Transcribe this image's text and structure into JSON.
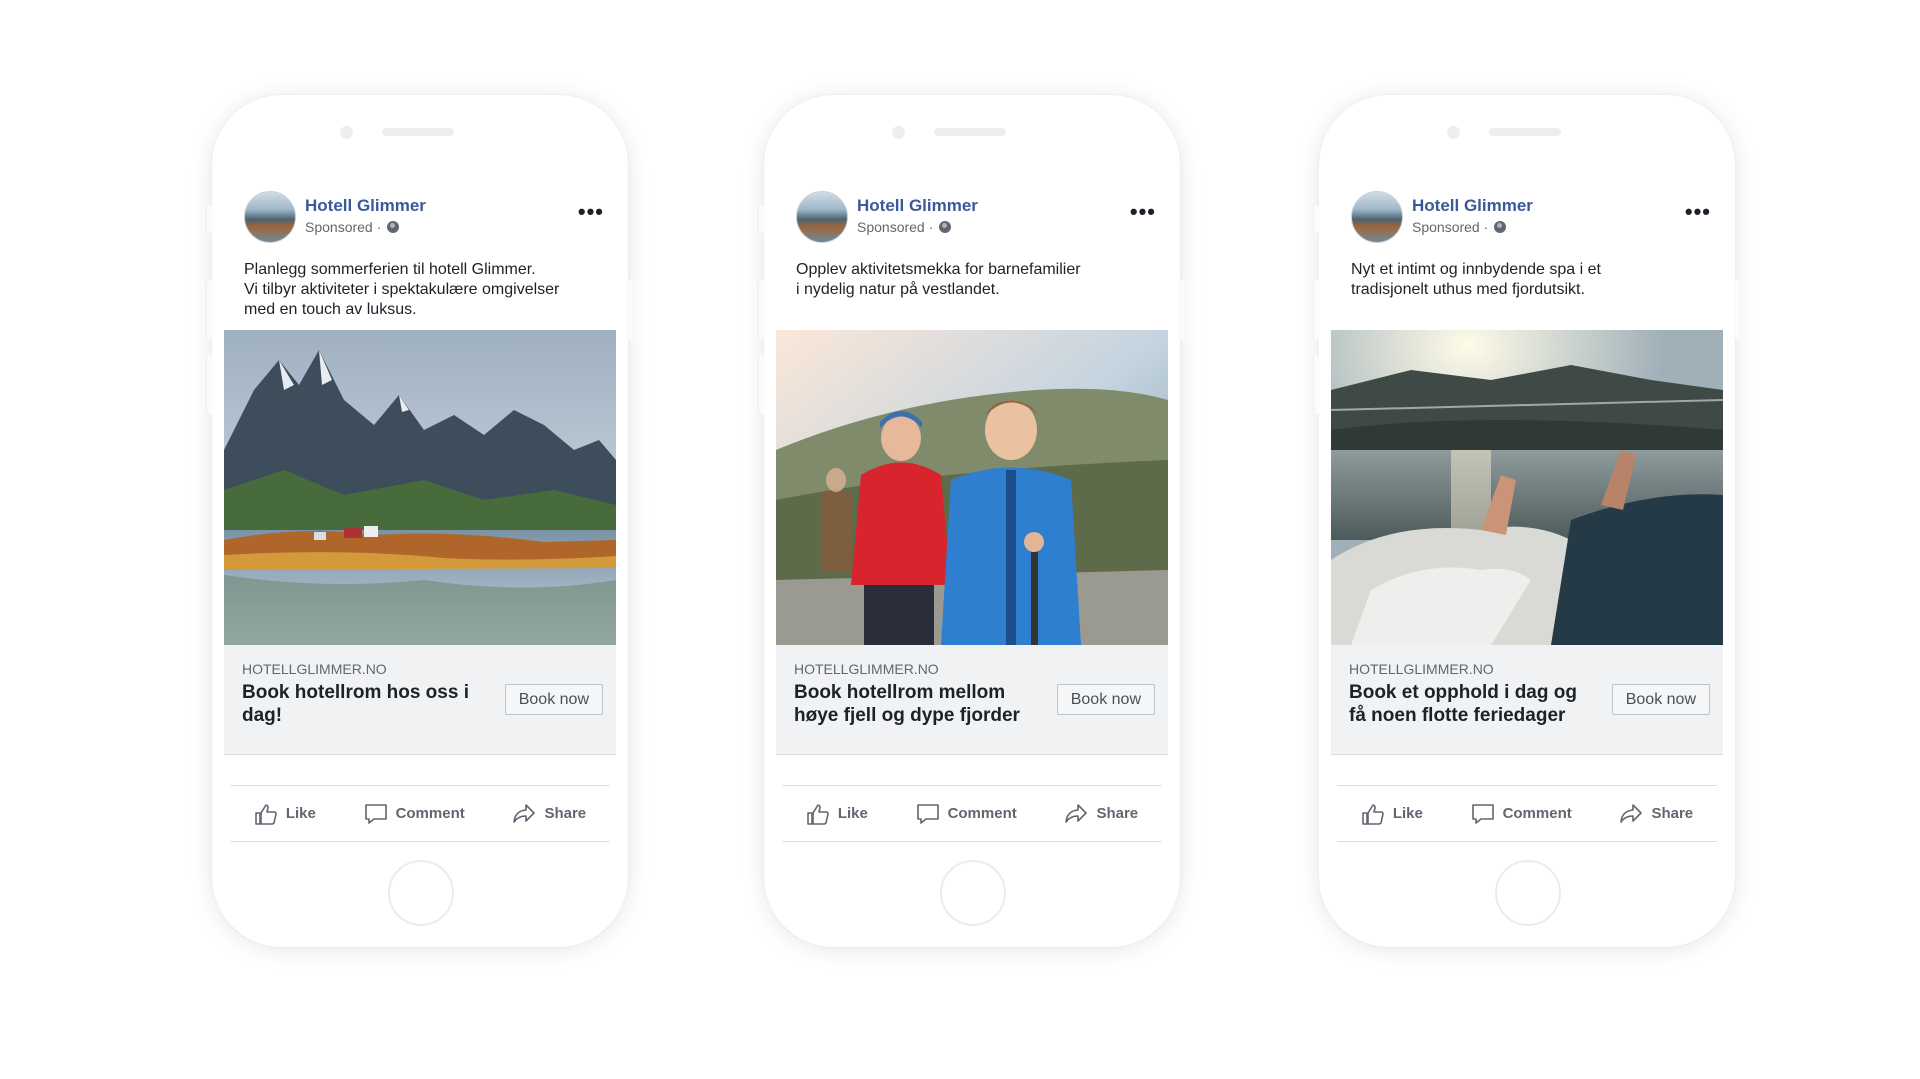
{
  "brand": {
    "page_name": "Hotell Glimmer",
    "sponsored": "Sponsored ·",
    "name_color": "#3b5998"
  },
  "actions": {
    "like": "Like",
    "comment": "Comment",
    "share": "Share"
  },
  "ads": [
    {
      "caption": "Planlegg sommerferien til hotell Glimmer.\nVi tilbyr aktiviteter i spektakulære omgivelser\nmed en touch av luksus.",
      "domain": "HOTELLGLIMMER.NO",
      "headline": "Book hotellrom hos oss i dag!",
      "button": "Book now",
      "image": "mountain-lake-photo"
    },
    {
      "caption": "Opplev aktivitetsmekka for barnefamilier\ni nydelig natur på vestlandet.",
      "domain": "HOTELLGLIMMER.NO",
      "headline": "Book hotellrom mellom høye fjell og dype fjorder",
      "button": "Book now",
      "image": "family-hiking-photo"
    },
    {
      "caption": "Nyt et intimt og innbydende spa i et\ntradisjonelt uthus med fjordutsikt.",
      "domain": "HOTELLGLIMMER.NO",
      "headline": "Book et opphold i dag og få noen flotte feriedager",
      "button": "Book now",
      "image": "spa-fjord-view-photo"
    }
  ]
}
